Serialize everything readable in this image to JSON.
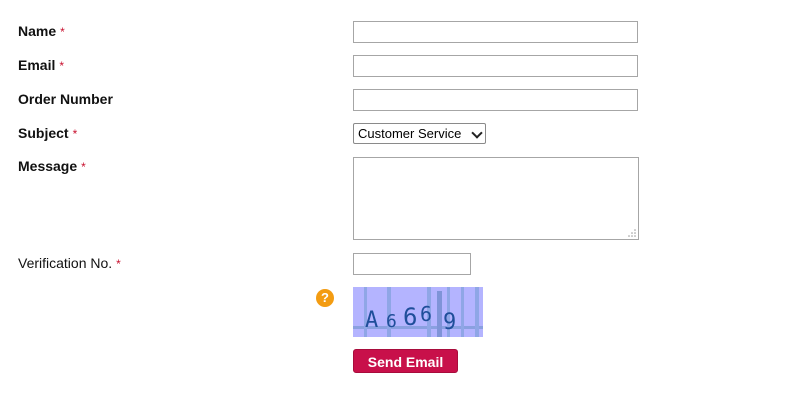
{
  "form": {
    "name_label": "Name",
    "email_label": "Email",
    "order_label": "Order Number",
    "subject_label": "Subject",
    "message_label": "Message",
    "verification_label": "Verification No.",
    "required_marker": "*",
    "subject_selected": "Customer Service",
    "help_icon_text": "?",
    "captcha_chars": [
      "A",
      "6",
      "6",
      "6",
      "9"
    ],
    "submit_label": "Send Email"
  },
  "colors": {
    "required": "#c8102e",
    "button": "#c8104a",
    "help_icon": "#f39c12",
    "captcha_bg": "#b4b4ff",
    "captcha_text": "#1f4e9a"
  }
}
